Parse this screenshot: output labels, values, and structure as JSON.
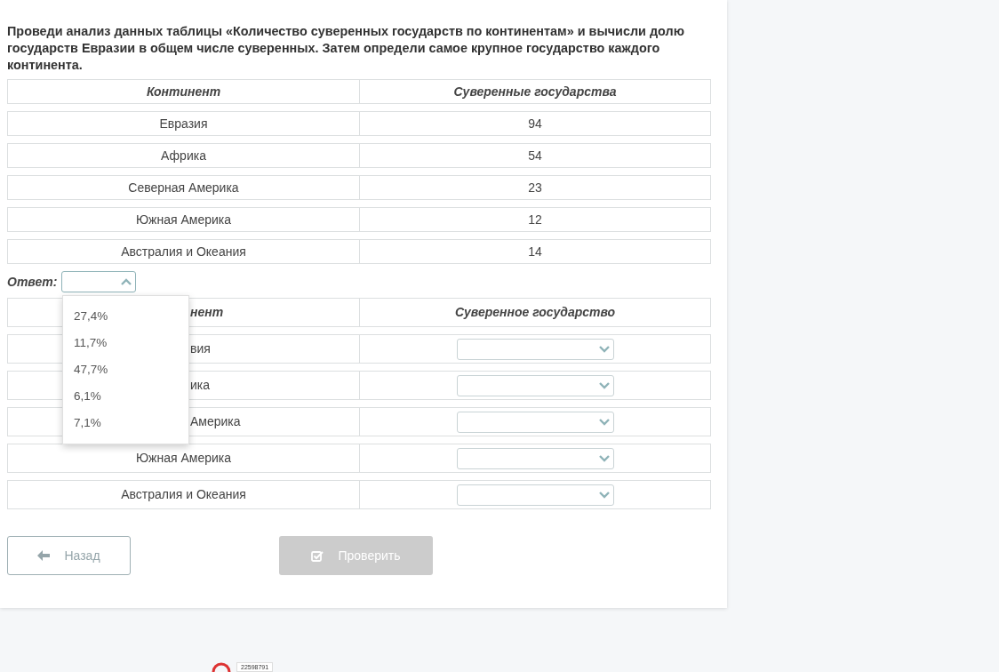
{
  "question": "Проведи анализ данных таблицы «Количество суверенных государств по континентам» и вычисли долю государств Евразии в общем числе суверенных. Затем определи самое крупное государство каждого континента.",
  "data_table": {
    "columns": [
      "Континент",
      "Суверенные государства"
    ],
    "rows": [
      [
        "Евразия",
        "94"
      ],
      [
        "Африка",
        "54"
      ],
      [
        "Северная Америка",
        "23"
      ],
      [
        "Южная Америка",
        "12"
      ],
      [
        "Австралия и Океания",
        "14"
      ]
    ]
  },
  "answer": {
    "label": "Ответ:",
    "expanded": true,
    "options": [
      "27,4%",
      "11,7%",
      "47,7%",
      "6,1%",
      "7,1%"
    ]
  },
  "answer_table": {
    "columns": [
      {
        "text": "нент",
        "kind": "partial"
      },
      {
        "text": "Суверенное государство",
        "kind": "full"
      }
    ],
    "rows": [
      {
        "continent": "вия",
        "kind": "partial"
      },
      {
        "continent": "ика",
        "kind": "partial"
      },
      {
        "continent": "Америка",
        "kind": "partial"
      },
      {
        "continent": "Южная Америка",
        "kind": "full"
      },
      {
        "continent": "Австралия и Океания",
        "kind": "full"
      }
    ]
  },
  "buttons": [
    {
      "label": "Назад",
      "kind": "back",
      "disabled": false
    },
    {
      "label": "Проверить",
      "kind": "check",
      "disabled": true
    }
  ],
  "footer_counter": "22598791"
}
